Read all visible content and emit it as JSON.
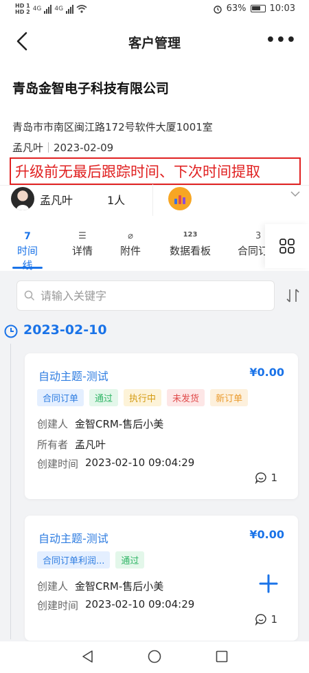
{
  "status_bar": {
    "hd1": "HD 1",
    "hd2": "HD 2",
    "net1": "4G",
    "net2": "4G",
    "battery": "63%",
    "time": "10:03"
  },
  "nav": {
    "title": "客户管理",
    "more": "•••"
  },
  "company": {
    "name": "青岛金智电子科技有限公司",
    "address": "青岛市市南区闽江路172号软件大厦1001室",
    "owner": "孟凡叶",
    "date": "2023-02-09",
    "notice": "升级前无最后跟踪时间、下次时间提取",
    "owner_row_name": "孟凡叶",
    "owner_row_count": "1人"
  },
  "tabs": [
    {
      "top": "7",
      "label": "时间线"
    },
    {
      "top": "☰",
      "label": "详情"
    },
    {
      "top": "⌀",
      "label": "附件"
    },
    {
      "top": "123",
      "label": "数据看板"
    },
    {
      "top": "3",
      "label": "合同订"
    }
  ],
  "search": {
    "placeholder": "请输入关键字"
  },
  "timeline": {
    "date": "2023-02-10",
    "cards": [
      {
        "title": "自动主题-测试",
        "amount": "¥0.00",
        "tags": [
          "合同订单",
          "通过",
          "执行中",
          "未发货",
          "新订单"
        ],
        "fields": [
          {
            "label": "创建人",
            "value": "金智CRM-售后小美"
          },
          {
            "label": "所有者",
            "value": "孟凡叶"
          },
          {
            "label": "创建时间",
            "value": "2023-02-10 09:04:29"
          }
        ],
        "comments": "1"
      },
      {
        "title": "自动主题-测试",
        "amount": "¥0.00",
        "tags": [
          "合同订单利润...",
          "通过"
        ],
        "fields": [
          {
            "label": "创建人",
            "value": "金智CRM-售后小美"
          },
          {
            "label": "创建时间",
            "value": "2023-02-10 09:04:29"
          }
        ],
        "comments": "1"
      }
    ]
  },
  "colors": {
    "accent": "#1a73e8",
    "notice": "#e02020",
    "badge": "#f7a623"
  }
}
